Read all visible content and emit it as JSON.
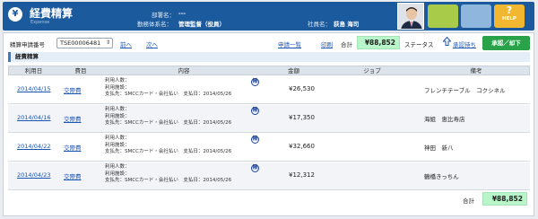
{
  "header": {
    "title": "経費精算",
    "subtitle": "Expense",
    "logo_icon": "yen-circle-icon",
    "dept_label": "部署名：",
    "dept_value": "---",
    "work_label": "勤務体系名：",
    "work_value": "管理監督（役員）",
    "employee_label": "社員名：",
    "employee_value": "荻島 海司",
    "help_label": "HELP",
    "help_mark": "?"
  },
  "toolbar": {
    "request_no_label": "精算申請番号",
    "request_no_value": "TSE00006481",
    "prev": "前へ",
    "next": "次へ",
    "apply_list": "申請一覧",
    "print": "印刷",
    "total_label": "合計",
    "total_value": "¥88,852",
    "status_label": "ステータス",
    "approval_status": "承認待ち",
    "approve_button": "承認／却下"
  },
  "section_title": "経費精算",
  "table": {
    "columns": [
      "利用日",
      "費目",
      "内容",
      "金額",
      "ジョブ",
      "備考"
    ],
    "rows": [
      {
        "date": "2014/04/15",
        "category": "交際費",
        "l1": "利用人数：",
        "l2": "利用施設：",
        "l3": "支払先：SMCCカード・会社払い　支払日：2014/05/26",
        "badge": "精",
        "amount": "¥26,530",
        "job": "",
        "note": "フレンチテーブル　コクシネル"
      },
      {
        "date": "2014/04/16",
        "category": "交際費",
        "l1": "利用人数：",
        "l2": "利用施設：",
        "l3": "支払先：SMCCカード・会社払い　支払日：2014/05/26",
        "badge": "精",
        "amount": "¥17,350",
        "job": "",
        "note": "海姐　恵比寿店"
      },
      {
        "date": "2014/04/22",
        "category": "交際費",
        "l1": "利用人数：",
        "l2": "利用施設：",
        "l3": "支払先：SMCCカード・会社払い　支払日：2014/05/26",
        "badge": "精",
        "amount": "¥32,660",
        "job": "",
        "note": "神田　新八"
      },
      {
        "date": "2014/04/23",
        "category": "交際費",
        "l1": "利用人数：",
        "l2": "利用施設：",
        "l3": "支払先：SMCCカード・会社払い　支払日：2014/05/26",
        "badge": "精",
        "amount": "¥12,312",
        "job": "",
        "note": "鶴橋きっちん"
      }
    ]
  },
  "footer": {
    "total_label": "合計",
    "total_value": "¥88,852"
  },
  "colors": {
    "header_bg": "#1b5a9c",
    "link": "#1d55b6",
    "total_bg": "#b8f5c8",
    "approve_bg": "#2aa24a",
    "help_tile": "#f2b731"
  }
}
